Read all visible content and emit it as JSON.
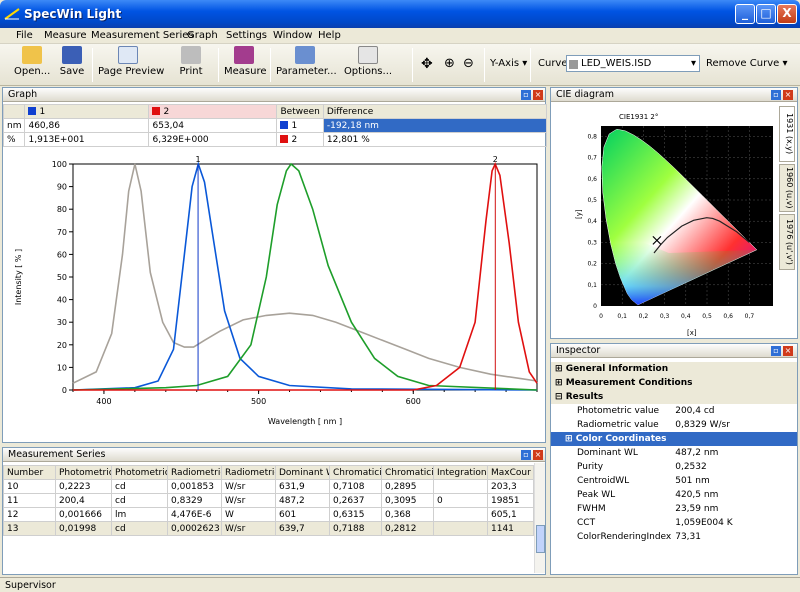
{
  "window": {
    "title": "SpecWin Light",
    "min": "_",
    "max": "□",
    "close": "X"
  },
  "menu": [
    "File",
    "Measure",
    "Measurement Series",
    "Graph",
    "Settings",
    "Window",
    "Help"
  ],
  "toolbar": {
    "open": "Open...",
    "save": "Save",
    "page_preview": "Page Preview",
    "print": "Print",
    "measure": "Measure",
    "parameter": "Parameter...",
    "options": "Options...",
    "y_axis": "Y-Axis",
    "curve_label": "Curve",
    "curve_value": "LED_WEIS.ISD",
    "remove_curve": "Remove Curve"
  },
  "graph": {
    "panel_title": "Graph",
    "header": {
      "c1": "1",
      "c2": "2",
      "between": "Between",
      "difference": "Difference"
    },
    "rows": [
      {
        "unit": "nm",
        "v1": "460,86",
        "v2": "653,04",
        "b": "1",
        "diff": "-192,18 nm"
      },
      {
        "unit": "%",
        "v1": "1,913E+001",
        "v2": "6,329E+000",
        "b": "2",
        "diff": "12,801 %"
      }
    ],
    "marker1": "1",
    "marker2": "2"
  },
  "chart_data": {
    "type": "line",
    "xlabel": "Wavelength [ nm ]",
    "ylabel": "Intensity [ % ]",
    "xlim": [
      380,
      680
    ],
    "ylim": [
      0,
      100
    ],
    "xticks": [
      "400",
      "500",
      "600"
    ],
    "yticks": [
      "0",
      "10",
      "20",
      "30",
      "40",
      "50",
      "60",
      "70",
      "80",
      "90",
      "100"
    ],
    "markers": [
      460.86,
      653.04
    ],
    "series": [
      {
        "color": "#a8a29a",
        "points": [
          [
            380,
            3
          ],
          [
            395,
            8
          ],
          [
            405,
            25
          ],
          [
            412,
            60
          ],
          [
            416,
            88
          ],
          [
            420,
            100
          ],
          [
            424,
            88
          ],
          [
            430,
            52
          ],
          [
            438,
            30
          ],
          [
            445,
            21
          ],
          [
            452,
            19
          ],
          [
            458,
            19
          ],
          [
            465,
            22
          ],
          [
            475,
            26
          ],
          [
            490,
            31
          ],
          [
            505,
            33
          ],
          [
            520,
            34
          ],
          [
            535,
            33
          ],
          [
            550,
            30
          ],
          [
            565,
            26
          ],
          [
            580,
            22
          ],
          [
            595,
            18
          ],
          [
            610,
            14
          ],
          [
            630,
            10
          ],
          [
            650,
            7
          ],
          [
            670,
            5
          ],
          [
            680,
            4
          ]
        ]
      },
      {
        "color": "#0a58d8",
        "points": [
          [
            380,
            0
          ],
          [
            420,
            1
          ],
          [
            435,
            4
          ],
          [
            445,
            18
          ],
          [
            452,
            60
          ],
          [
            457,
            90
          ],
          [
            461,
            100
          ],
          [
            465,
            92
          ],
          [
            470,
            70
          ],
          [
            478,
            35
          ],
          [
            488,
            14
          ],
          [
            500,
            6
          ],
          [
            520,
            2
          ],
          [
            560,
            0.5
          ],
          [
            680,
            0
          ]
        ]
      },
      {
        "color": "#1e9e2a",
        "points": [
          [
            380,
            0
          ],
          [
            440,
            1
          ],
          [
            460,
            2
          ],
          [
            480,
            6
          ],
          [
            495,
            20
          ],
          [
            505,
            50
          ],
          [
            512,
            82
          ],
          [
            518,
            97
          ],
          [
            521,
            100
          ],
          [
            526,
            97
          ],
          [
            535,
            80
          ],
          [
            545,
            55
          ],
          [
            560,
            30
          ],
          [
            575,
            14
          ],
          [
            590,
            6
          ],
          [
            610,
            2
          ],
          [
            680,
            0
          ]
        ]
      },
      {
        "color": "#e01010",
        "points": [
          [
            380,
            0
          ],
          [
            600,
            0
          ],
          [
            615,
            2
          ],
          [
            630,
            10
          ],
          [
            640,
            30
          ],
          [
            647,
            75
          ],
          [
            651,
            97
          ],
          [
            653,
            100
          ],
          [
            656,
            95
          ],
          [
            662,
            65
          ],
          [
            668,
            30
          ],
          [
            675,
            8
          ],
          [
            680,
            3
          ]
        ]
      }
    ]
  },
  "series_panel": {
    "title": "Measurement Series",
    "columns": [
      "Number",
      "Photometric",
      "Photometric",
      "Radiometric",
      "Radiometric",
      "Dominant W",
      "Chromaticity",
      "Chromaticity",
      "Integration ti",
      "MaxCour"
    ],
    "rows": [
      [
        "10",
        "0,2223",
        "cd",
        "0,001853",
        "W/sr",
        "631,9",
        "0,7108",
        "0,2895",
        "",
        "203,3"
      ],
      [
        "11",
        "200,4",
        "cd",
        "0,8329",
        "W/sr",
        "487,2",
        "0,2637",
        "0,3095",
        "0",
        "19851"
      ],
      [
        "12",
        "0,001666",
        "lm",
        "4,476E-6",
        "W",
        "601",
        "0,6315",
        "0,368",
        "",
        "605,1"
      ],
      [
        "13",
        "0,01998",
        "cd",
        "0,0002623",
        "W/sr",
        "639,7",
        "0,7188",
        "0,2812",
        "",
        "1141"
      ]
    ]
  },
  "cie": {
    "title": "CIE diagram",
    "subtitle": "CIE1931 2°",
    "xlabel": "[x]",
    "ylabel": "[y]",
    "xticks": [
      "0",
      "0,1",
      "0,2",
      "0,3",
      "0,4",
      "0,5",
      "0,6",
      "0,7"
    ],
    "yticks": [
      "0",
      "0,1",
      "0,2",
      "0,3",
      "0,4",
      "0,5",
      "0,6",
      "0,7",
      "0,8"
    ],
    "tabs": [
      "1931 (x,y)",
      "1960 (u,v)",
      "1976 (u',v')"
    ]
  },
  "inspector": {
    "title": "Inspector",
    "general": "General Information",
    "conditions": "Measurement Conditions",
    "results": "Results",
    "rows1": [
      [
        "Photometric value",
        "200,4 cd"
      ],
      [
        "Radiometric value",
        "0,8329 W/sr"
      ]
    ],
    "color_coords": "Color Coordinates",
    "rows2": [
      [
        "Dominant WL",
        "487,2 nm"
      ],
      [
        "Purity",
        "0,2532"
      ],
      [
        "CentroidWL",
        "501 nm"
      ],
      [
        "Peak WL",
        "420,5 nm"
      ],
      [
        "FWHM",
        "23,59 nm"
      ],
      [
        "CCT",
        "1,059E004 K"
      ],
      [
        "ColorRenderingIndex",
        "73,31"
      ]
    ]
  },
  "status": "Supervisor"
}
